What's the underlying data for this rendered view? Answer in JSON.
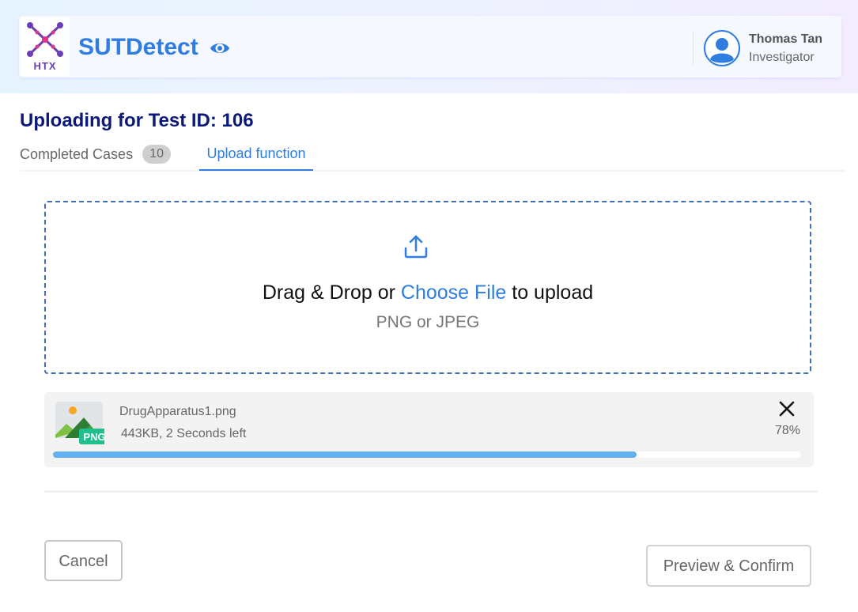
{
  "header": {
    "logo_text": "HTX",
    "app_title": "SUTDetect",
    "user": {
      "name": "Thomas Tan",
      "role": "Investigator"
    }
  },
  "page": {
    "title": "Uploading for Test ID: 106"
  },
  "tabs": [
    {
      "label": "Completed Cases",
      "badge": "10",
      "active": false
    },
    {
      "label": "Upload function",
      "active": true
    }
  ],
  "dropzone": {
    "prefix": "Drag & Drop or ",
    "link": "Choose File",
    "suffix": " to upload",
    "hint": "PNG or JPEG"
  },
  "upload": {
    "file_name": "DrugApparatus1.png",
    "meta": "443KB, 2 Seconds left",
    "percent_label": "78%",
    "progress": 0.78,
    "file_type_badge": "PNG"
  },
  "buttons": {
    "cancel": "Cancel",
    "confirm": "Preview & Confirm"
  },
  "colors": {
    "accent": "#2f7de0",
    "title": "#0b1a7a",
    "progress": "#62b0f2",
    "badge": "#1fbf8f"
  },
  "icons": [
    "htx-logo",
    "eye-icon",
    "user-avatar-icon",
    "upload-icon",
    "image-file-icon",
    "close-icon"
  ]
}
